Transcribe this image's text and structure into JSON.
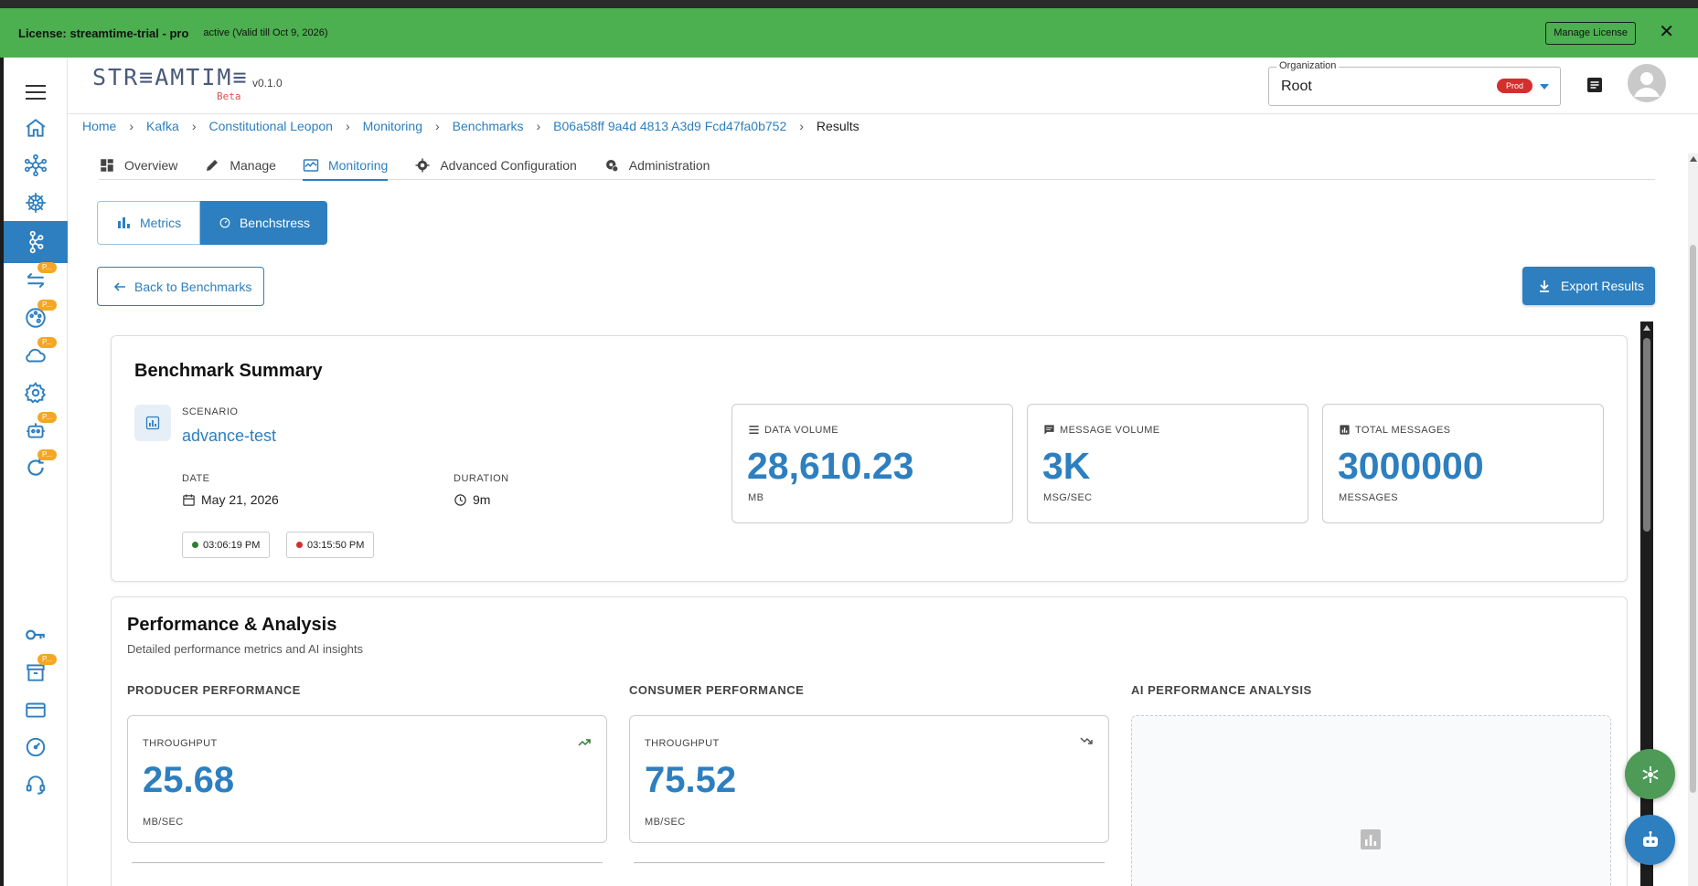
{
  "license": {
    "label": "License: streamtime-trial - pro",
    "status": "active (Valid till Oct 9, 2026)",
    "manage_button": "Manage License",
    "close": "✕"
  },
  "header": {
    "logo": "STR≡AMTIM≡",
    "logo_beta": "Beta",
    "version": "v0.1.0",
    "organization": {
      "label": "Organization",
      "value": "Root",
      "badge": "Prod"
    }
  },
  "sidebar": {
    "badge": "P..."
  },
  "breadcrumb": {
    "items": [
      "Home",
      "Kafka",
      "Constitutional Leopon",
      "Monitoring",
      "Benchmarks",
      "B06a58ff 9a4d 4813 A3d9 Fcd47fa0b752"
    ],
    "current": "Results"
  },
  "tabs": [
    {
      "label": "Overview",
      "icon": "dashboard-icon"
    },
    {
      "label": "Manage",
      "icon": "pencil-icon"
    },
    {
      "label": "Monitoring",
      "icon": "monitoring-icon",
      "active": true
    },
    {
      "label": "Advanced Configuration",
      "icon": "gear-icon"
    },
    {
      "label": "Administration",
      "icon": "admin-gear-icon"
    }
  ],
  "subtabs": {
    "metrics": "Metrics",
    "benchstress": "Benchstress",
    "active": "Benchstress"
  },
  "actions": {
    "back": "Back to Benchmarks",
    "export": "Export Results"
  },
  "summary": {
    "title": "Benchmark Summary",
    "scenario_label": "SCENARIO",
    "scenario": "advance-test",
    "date_label": "DATE",
    "date": "May 21, 2026",
    "duration_label": "DURATION",
    "duration": "9m",
    "start_time": "03:06:19 PM",
    "end_time": "03:15:50 PM",
    "metrics": [
      {
        "label": "DATA VOLUME",
        "value": "28,610.23",
        "unit": "MB",
        "icon": "list-icon"
      },
      {
        "label": "MESSAGE VOLUME",
        "value": "3K",
        "unit": "MSG/SEC",
        "icon": "chat-icon"
      },
      {
        "label": "TOTAL MESSAGES",
        "value": "3000000",
        "unit": "MESSAGES",
        "icon": "chart-box-icon"
      }
    ]
  },
  "performance": {
    "title": "Performance & Analysis",
    "subtitle": "Detailed performance metrics and AI insights",
    "producer": {
      "heading": "PRODUCER PERFORMANCE",
      "label": "THROUGHPUT",
      "value": "25.68",
      "unit": "MB/SEC",
      "trend": "up"
    },
    "consumer": {
      "heading": "CONSUMER PERFORMANCE",
      "label": "THROUGHPUT",
      "value": "75.52",
      "unit": "MB/SEC",
      "trend": "down"
    },
    "ai_heading": "AI PERFORMANCE ANALYSIS"
  },
  "colors": {
    "primary": "#2d7fbf",
    "license_bar": "#4caf50",
    "badge_orange": "#f5a623",
    "prod_red": "#d32f2f",
    "fab_green": "#4e9a57"
  }
}
